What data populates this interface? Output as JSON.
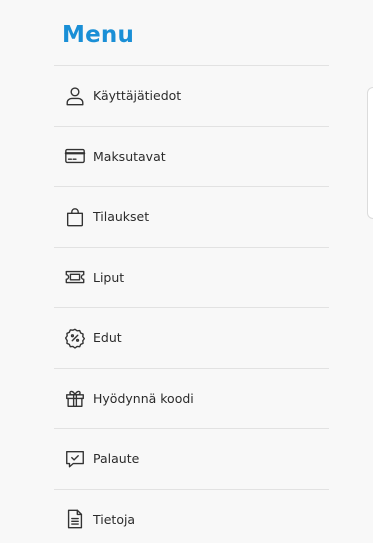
{
  "menu": {
    "title": "Menu",
    "items": [
      {
        "label": "Käyttäjätiedot",
        "icon": "user-icon"
      },
      {
        "label": "Maksutavat",
        "icon": "credit-card-icon"
      },
      {
        "label": "Tilaukset",
        "icon": "shopping-bag-icon"
      },
      {
        "label": "Liput",
        "icon": "ticket-icon"
      },
      {
        "label": "Edut",
        "icon": "discount-badge-icon"
      },
      {
        "label": "Hyödynnä koodi",
        "icon": "gift-icon"
      },
      {
        "label": "Palaute",
        "icon": "feedback-icon"
      },
      {
        "label": "Tietoja",
        "icon": "document-icon"
      }
    ]
  },
  "colors": {
    "accent": "#1a8fd6",
    "text": "#2b2b2b",
    "divider": "#e2e2e2",
    "background": "#f8f8f8"
  }
}
